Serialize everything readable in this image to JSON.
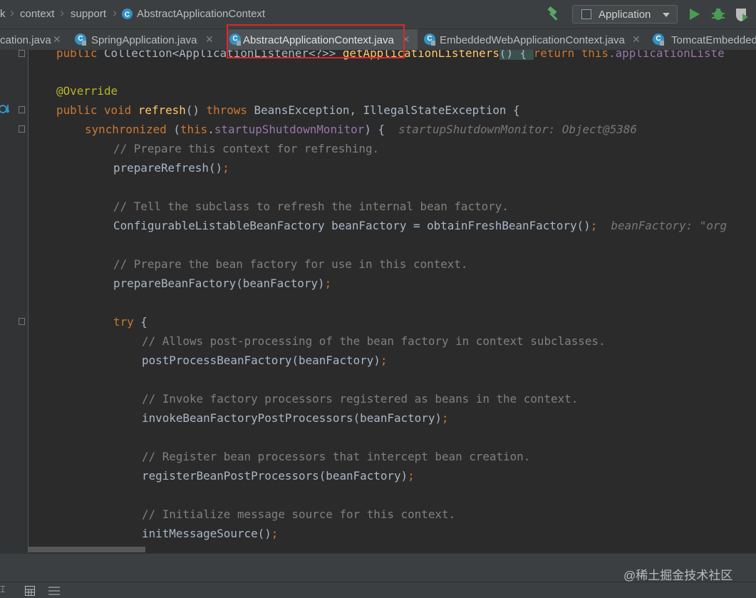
{
  "breadcrumbs": [
    "k",
    "context",
    "support",
    "AbstractApplicationContext"
  ],
  "run_config": {
    "label": "Application"
  },
  "toolbar_icons": [
    "build-hammer-icon",
    "run-icon",
    "debug-icon",
    "coverage-icon"
  ],
  "tabs": [
    {
      "label": "cation.java",
      "active": false
    },
    {
      "label": "SpringApplication.java",
      "active": false
    },
    {
      "label": "AbstractApplicationContext.java",
      "active": true,
      "highlighted": true
    },
    {
      "label": "EmbeddedWebApplicationContext.java",
      "active": false
    },
    {
      "label": "TomcatEmbedded",
      "active": false
    }
  ],
  "code": {
    "l0": {
      "a": "public",
      "b": "Collection<ApplicationListener<?>>",
      "c": "getApplicationListeners",
      "d": "() { ",
      "e": "return",
      "f": "this",
      "g": ".applicationListe"
    },
    "l1": {
      "a": "@Override"
    },
    "l2": {
      "a": "public",
      "b": "void",
      "c": "refresh",
      "d": "() ",
      "e": "throws",
      "f": "BeansException, IllegalStateException {"
    },
    "l3": {
      "a": "synchronized",
      "b": "(",
      "c": "this",
      "d": ".",
      "e": "startupShutdownMonitor",
      "f": ") {",
      "hint": "startupShutdownMonitor: Object@5386"
    },
    "l4": {
      "a": "// Prepare this context for refreshing."
    },
    "l5": {
      "a": "prepareRefresh()",
      "b": ";"
    },
    "l6": {
      "a": "// Tell the subclass to refresh the internal bean factory."
    },
    "l7": {
      "a": "ConfigurableListableBeanFactory beanFactory = obtainFreshBeanFactory()",
      "b": ";",
      "hint": "beanFactory: \"org"
    },
    "l8": {
      "a": "// Prepare the bean factory for use in this context."
    },
    "l9": {
      "a": "prepareBeanFactory(beanFactory)",
      "b": ";"
    },
    "l10": {
      "a": "try",
      "b": " {"
    },
    "l11": {
      "a": "// Allows post-processing of the bean factory in context subclasses."
    },
    "l12": {
      "a": "postProcessBeanFactory(beanFactory)",
      "b": ";"
    },
    "l13": {
      "a": "// Invoke factory processors registered as beans in the context."
    },
    "l14": {
      "a": "invokeBeanFactoryPostProcessors(beanFactory)",
      "b": ";"
    },
    "l15": {
      "a": "// Register bean processors that intercept bean creation."
    },
    "l16": {
      "a": "registerBeanPostProcessors(beanFactory)",
      "b": ";"
    },
    "l17": {
      "a": "// Initialize message source for this context."
    },
    "l18": {
      "a": "initMessageSource()",
      "b": ";"
    }
  },
  "watermark": "@稀土掘金技术社区",
  "colors": {
    "background": "#2b2b2b",
    "keyword": "#cc7832",
    "method": "#ffc66d",
    "annotation": "#bbb529",
    "field": "#9876aa",
    "comment": "#808080",
    "highlight_border": "#e0262a"
  }
}
